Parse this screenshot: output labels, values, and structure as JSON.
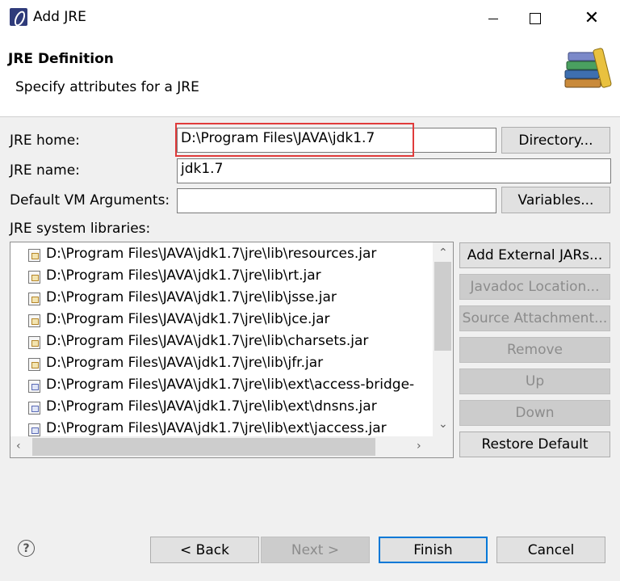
{
  "window": {
    "title": "Add JRE",
    "icon": "eclipse-app-icon"
  },
  "header": {
    "title": "JRE Definition",
    "description": "Specify attributes for a JRE",
    "icon": "library-books-icon"
  },
  "form": {
    "jre_home_label": "JRE home:",
    "jre_home_value": "D:\\Program Files\\JAVA\\jdk1.7",
    "directory_button": "Directory...",
    "jre_name_label": "JRE name:",
    "jre_name_value": "jdk1.7",
    "vm_args_label": "Default VM Arguments:",
    "vm_args_value": "",
    "variables_button": "Variables..."
  },
  "libraries": {
    "label": "JRE system libraries:",
    "items": [
      "D:\\Program Files\\JAVA\\jdk1.7\\jre\\lib\\resources.jar",
      "D:\\Program Files\\JAVA\\jdk1.7\\jre\\lib\\rt.jar",
      "D:\\Program Files\\JAVA\\jdk1.7\\jre\\lib\\jsse.jar",
      "D:\\Program Files\\JAVA\\jdk1.7\\jre\\lib\\jce.jar",
      "D:\\Program Files\\JAVA\\jdk1.7\\jre\\lib\\charsets.jar",
      "D:\\Program Files\\JAVA\\jdk1.7\\jre\\lib\\jfr.jar",
      "D:\\Program Files\\JAVA\\jdk1.7\\jre\\lib\\ext\\access-bridge-",
      "D:\\Program Files\\JAVA\\jdk1.7\\jre\\lib\\ext\\dnsns.jar",
      "D:\\Program Files\\JAVA\\jdk1.7\\jre\\lib\\ext\\jaccess.jar"
    ],
    "buttons": {
      "add_external_jars": "Add External JARs...",
      "javadoc_location": "Javadoc Location...",
      "source_attachment": "Source Attachment...",
      "remove": "Remove",
      "up": "Up",
      "down": "Down",
      "restore_default": "Restore Default"
    }
  },
  "footer": {
    "back": "< Back",
    "next": "Next >",
    "finish": "Finish",
    "cancel": "Cancel"
  },
  "colors": {
    "highlight_box": "#e03b3b",
    "primary_border": "#0078d7"
  }
}
